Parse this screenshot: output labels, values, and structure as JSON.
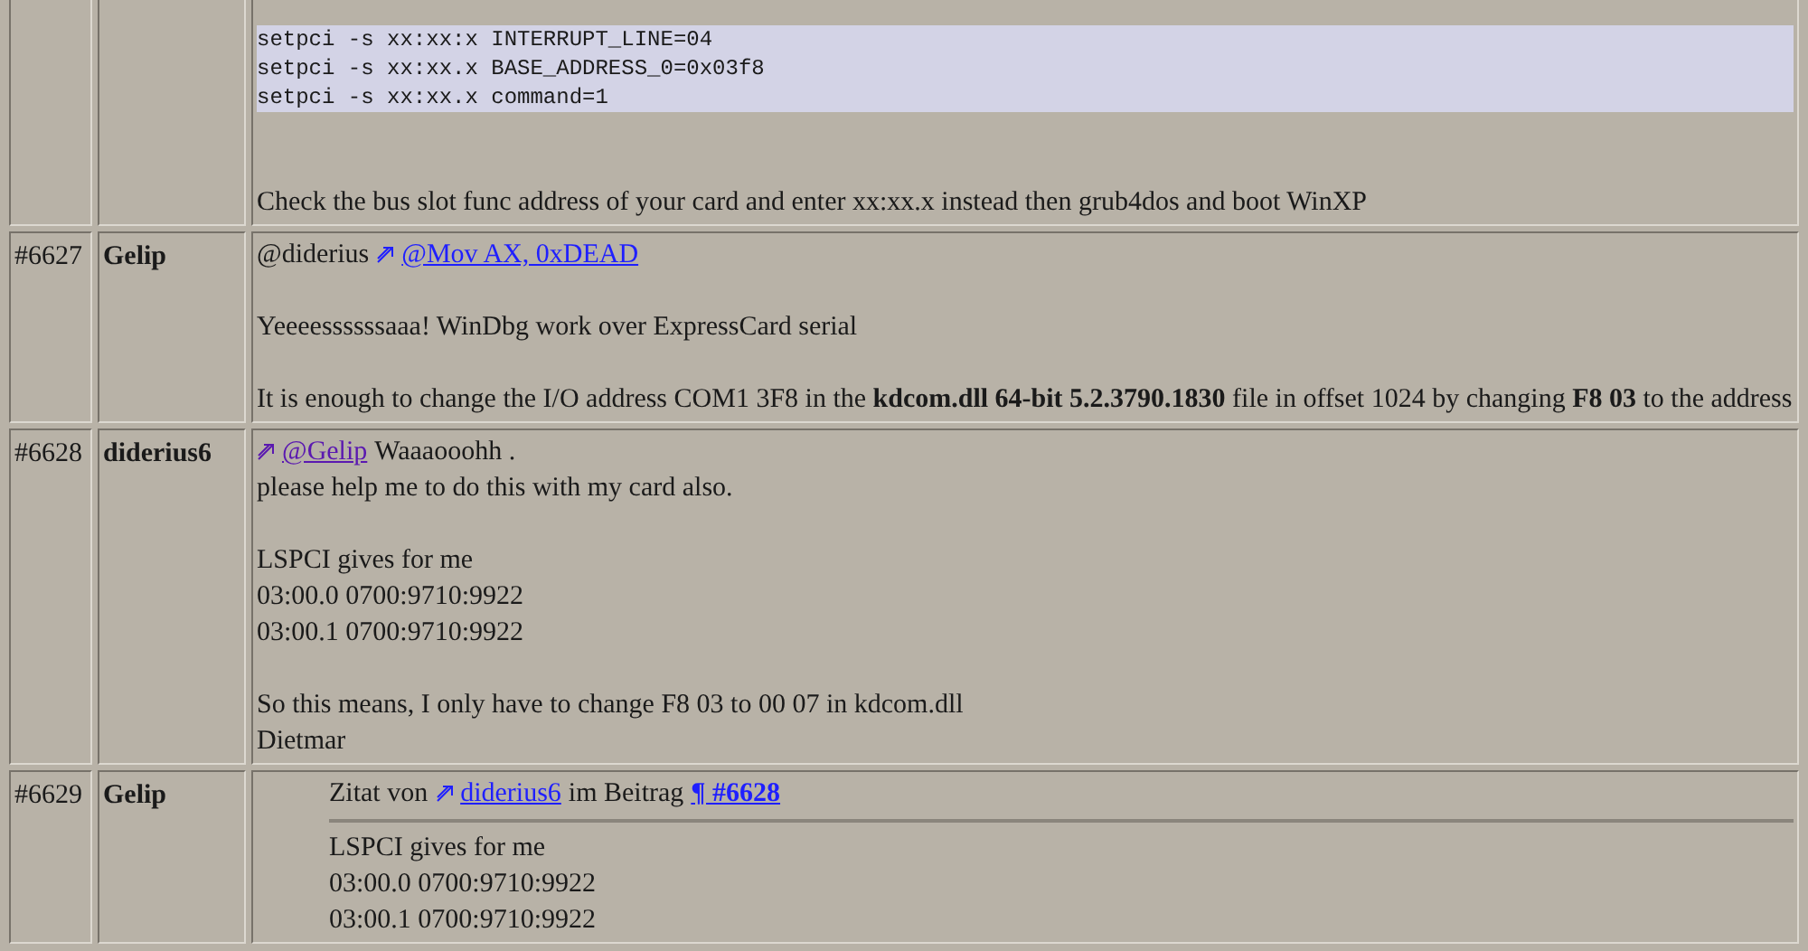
{
  "posts": [
    {
      "blocks": [
        {
          "kind": "blank"
        },
        {
          "kind": "code",
          "lines": [
            "setpci -s xx:xx:x INTERRUPT_LINE=04",
            "setpci -s xx:xx.x BASE_ADDRESS_0=0x03f8",
            "setpci -s xx:xx.x command=1"
          ]
        },
        {
          "kind": "blank"
        },
        {
          "kind": "blank"
        },
        {
          "kind": "line",
          "parts": [
            {
              "kind": "text",
              "text": "Check the bus slot func address of your card and enter xx:xx.x instead then grub4dos and boot WinXP"
            }
          ]
        }
      ]
    },
    {
      "number": "#6627",
      "author": "Gelip",
      "blocks": [
        {
          "kind": "line",
          "parts": [
            {
              "kind": "text",
              "text": "@diderius"
            },
            {
              "kind": "link",
              "text": "@Mov AX, 0xDEAD",
              "visited": false,
              "bold": false
            }
          ]
        },
        {
          "kind": "blank"
        },
        {
          "kind": "line",
          "parts": [
            {
              "kind": "text",
              "text": "Yeeeessssssaaa! WinDbg work over ExpressCard serial"
            }
          ]
        },
        {
          "kind": "blank"
        },
        {
          "kind": "line",
          "parts": [
            {
              "kind": "text",
              "text": "It is enough to change the I/O address COM1 3F8 in the **kdcom.dll 64-bit 5.2.3790.1830** file in offset 1024 by changing **F8 03** to the address"
            }
          ]
        }
      ]
    },
    {
      "number": "#6628",
      "author": "diderius6",
      "blocks": [
        {
          "kind": "line",
          "parts": [
            {
              "kind": "link",
              "text": "@Gelip",
              "visited": true,
              "bold": false
            },
            {
              "kind": "text",
              "text": "Waaaooohh  ."
            }
          ]
        },
        {
          "kind": "line",
          "parts": [
            {
              "kind": "text",
              "text": "please help me to do this with my card also."
            }
          ]
        },
        {
          "kind": "blank"
        },
        {
          "kind": "line",
          "parts": [
            {
              "kind": "text",
              "text": "LSPCI gives for me"
            }
          ]
        },
        {
          "kind": "line",
          "parts": [
            {
              "kind": "text",
              "text": "03:00.0 0700:9710:9922"
            }
          ]
        },
        {
          "kind": "line",
          "parts": [
            {
              "kind": "text",
              "text": "03:00.1 0700:9710:9922"
            }
          ]
        },
        {
          "kind": "blank"
        },
        {
          "kind": "line",
          "parts": [
            {
              "kind": "text",
              "text": "So this means, I only have to change F8 03 to 00 07 in kdcom.dll"
            }
          ]
        },
        {
          "kind": "line",
          "parts": [
            {
              "kind": "text",
              "text": "Dietmar"
            }
          ]
        }
      ]
    },
    {
      "number": "#6629",
      "author": "Gelip",
      "blocks": [
        {
          "kind": "quote",
          "header": [
            {
              "kind": "text",
              "text": "Zitat von"
            },
            {
              "kind": "link",
              "text": "diderius6",
              "visited": false,
              "bold": false
            },
            {
              "kind": "text",
              "text": "im Beitrag"
            },
            {
              "kind": "pilcrow-link",
              "text": "¶ #6628",
              "visited": false,
              "bold": true
            }
          ],
          "lines": [
            "LSPCI gives for me",
            "03:00.0 0700:9710:9922",
            "03:00.1 0700:9710:9922"
          ]
        }
      ]
    }
  ]
}
